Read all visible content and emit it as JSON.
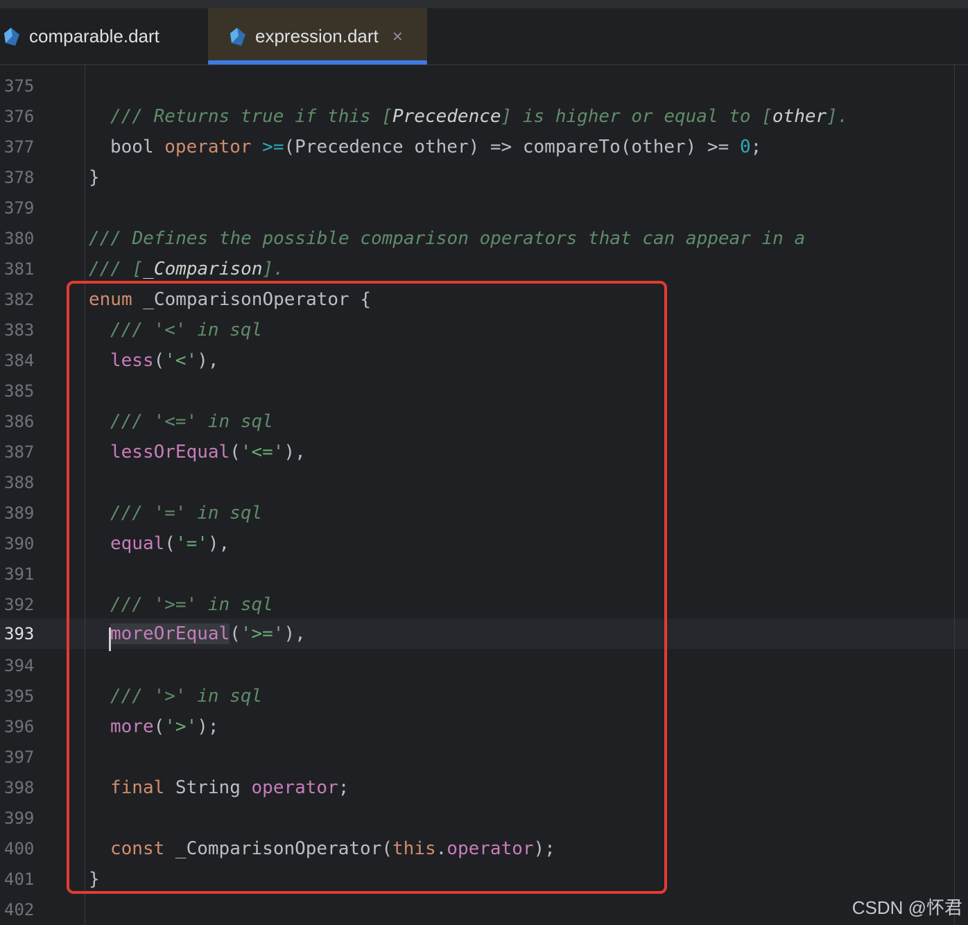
{
  "tabs": [
    {
      "label": "comparable.dart",
      "icon": "dart-file-icon",
      "active": false
    },
    {
      "label": "expression.dart",
      "icon": "dart-file-icon",
      "active": true,
      "close_icon": "close-icon",
      "close_glyph": "×"
    }
  ],
  "editor": {
    "current_line": "393",
    "lines": [
      {
        "num": "375",
        "text": ""
      },
      {
        "num": "376",
        "text": "/// Returns true if this [Precedence] is higher or equal to [other]."
      },
      {
        "num": "377",
        "text": "bool operator >=(Precedence other) => compareTo(other) >= 0;"
      },
      {
        "num": "378",
        "text": "}"
      },
      {
        "num": "379",
        "text": ""
      },
      {
        "num": "380",
        "text": "/// Defines the possible comparison operators that can appear in a"
      },
      {
        "num": "381",
        "text": "/// [_Comparison]."
      },
      {
        "num": "382",
        "text": "enum _ComparisonOperator {"
      },
      {
        "num": "383",
        "text": "/// '<' in sql"
      },
      {
        "num": "384",
        "text": "less('<'),"
      },
      {
        "num": "385",
        "text": ""
      },
      {
        "num": "386",
        "text": "/// '<=' in sql"
      },
      {
        "num": "387",
        "text": "lessOrEqual('<='),"
      },
      {
        "num": "388",
        "text": ""
      },
      {
        "num": "389",
        "text": "/// '=' in sql"
      },
      {
        "num": "390",
        "text": "equal('='),"
      },
      {
        "num": "391",
        "text": ""
      },
      {
        "num": "392",
        "text": "/// '>=' in sql"
      },
      {
        "num": "393",
        "text": "moreOrEqual('>='),"
      },
      {
        "num": "394",
        "text": ""
      },
      {
        "num": "395",
        "text": "/// '>' in sql"
      },
      {
        "num": "396",
        "text": "more('>');"
      },
      {
        "num": "397",
        "text": ""
      },
      {
        "num": "398",
        "text": "final String operator;"
      },
      {
        "num": "399",
        "text": ""
      },
      {
        "num": "400",
        "text": "const _ComparisonOperator(this.operator);"
      },
      {
        "num": "401",
        "text": "}"
      },
      {
        "num": "402",
        "text": ""
      }
    ]
  },
  "annotation": {
    "color": "#e23c2f"
  },
  "watermark": "CSDN @怀君",
  "colors": {
    "background": "#1f2023",
    "comment": "#5f8c6a",
    "keyword": "#cf8e6d",
    "enum_member": "#c77dbb",
    "string": "#6aab73",
    "number": "#2aacb8",
    "tab_accent": "#3d7be3"
  }
}
